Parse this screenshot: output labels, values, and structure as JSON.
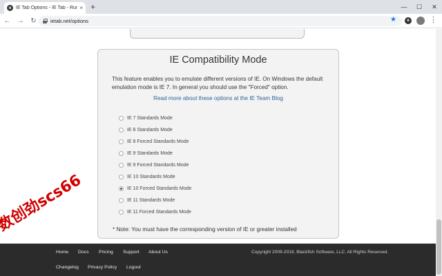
{
  "browser": {
    "tab_title": "IE Tab Options - IE Tab - Run Inter...",
    "tab_favicon_letter": "e",
    "new_tab_symbol": "+",
    "close_symbol": "×",
    "url": "ietab.net/options",
    "ext_letter": "e",
    "window_minimize": "—",
    "window_maximize": "☐",
    "window_close": "✕",
    "back_symbol": "←",
    "forward_symbol": "→",
    "reload_symbol": "↻",
    "star_symbol": "★",
    "menu_symbol": "⋮"
  },
  "panel": {
    "title": "IE Compatibility Mode",
    "description": "This feature enables you to emulate different versions of IE. On Windows the default emulation mode is IE 7. In general you should use the \"Forced\" option.",
    "link": "Read more about these options at the IE Team Blog",
    "options": [
      {
        "label": "IE 7 Standards Mode",
        "checked": false
      },
      {
        "label": "IE 8 Standards Mode",
        "checked": false
      },
      {
        "label": "IE 8 Forced Standards Mode",
        "checked": false
      },
      {
        "label": "IE 9 Standards Mode",
        "checked": false
      },
      {
        "label": "IE 9 Forced Standards Mode",
        "checked": false
      },
      {
        "label": "IE 10 Standards Mode",
        "checked": false
      },
      {
        "label": "IE 10 Forced Standards Mode",
        "checked": true
      },
      {
        "label": "IE 11 Standards Mode",
        "checked": false
      },
      {
        "label": "IE 11 Forced Standards Mode",
        "checked": false
      }
    ],
    "note": "* Note: You must have the corresponding version of IE or greater installed"
  },
  "footer": {
    "links_row1": [
      "Home",
      "Docs",
      "Pricing",
      "Support",
      "About Us"
    ],
    "links_row2": [
      "Changelog",
      "Privacy Policy",
      "Logout"
    ],
    "copyright": "Copyright 2009-2019, Blackfish Software, LLC. All Rights Reserved."
  },
  "watermark": "数创劲scs66"
}
